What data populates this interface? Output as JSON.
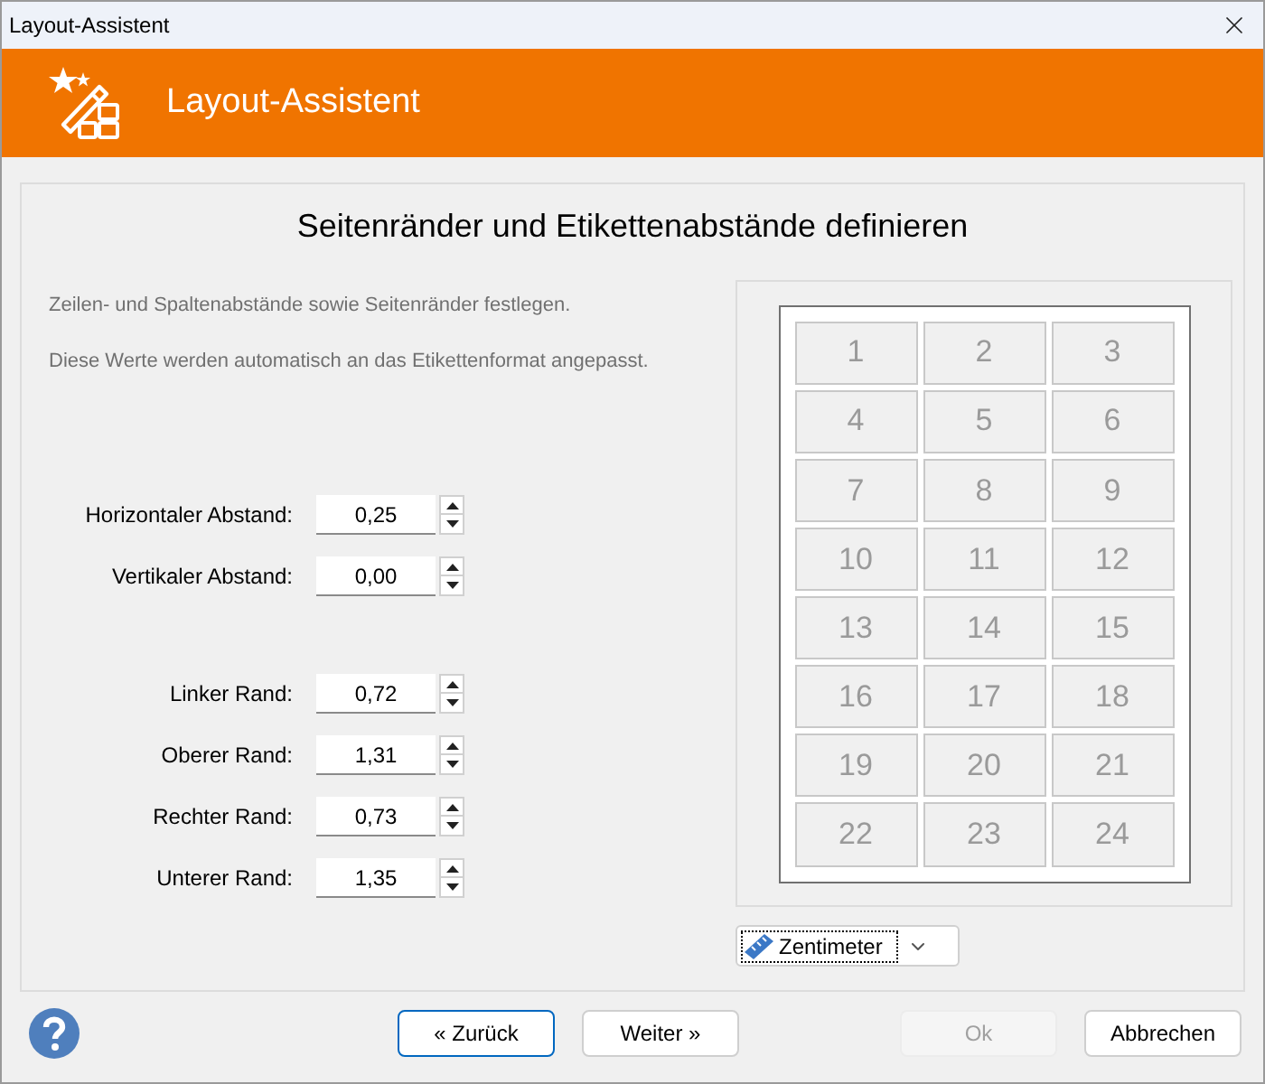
{
  "window": {
    "title": "Layout-Assistent"
  },
  "header": {
    "title": "Layout-Assistent"
  },
  "heading": "Seitenränder und Etikettenabstände definieren",
  "intro": [
    "Zeilen- und Spaltenabstände sowie Seitenränder festlegen.",
    "Diese Werte werden automatisch an das Etikettenformat angepasst."
  ],
  "field_groups": [
    [
      {
        "label": "Horizontaler Abstand:",
        "value": "0,25"
      },
      {
        "label": "Vertikaler Abstand:",
        "value": "0,00"
      }
    ],
    [
      {
        "label": "Linker Rand:",
        "value": "0,72"
      },
      {
        "label": "Oberer Rand:",
        "value": "1,31"
      },
      {
        "label": "Rechter Rand:",
        "value": "0,73"
      },
      {
        "label": "Unterer Rand:",
        "value": "1,35"
      }
    ]
  ],
  "preview": {
    "labels": [
      "1",
      "2",
      "3",
      "4",
      "5",
      "6",
      "7",
      "8",
      "9",
      "10",
      "11",
      "12",
      "13",
      "14",
      "15",
      "16",
      "17",
      "18",
      "19",
      "20",
      "21",
      "22",
      "23",
      "24"
    ]
  },
  "unit_select": {
    "value": "Zentimeter"
  },
  "buttons": [
    {
      "label": "« Zurück",
      "default": true,
      "disabled": false
    },
    {
      "label": "Weiter »",
      "default": false,
      "disabled": false
    },
    {
      "label": "Ok",
      "default": false,
      "disabled": true
    },
    {
      "label": "Abbrechen",
      "default": false,
      "disabled": false
    }
  ]
}
